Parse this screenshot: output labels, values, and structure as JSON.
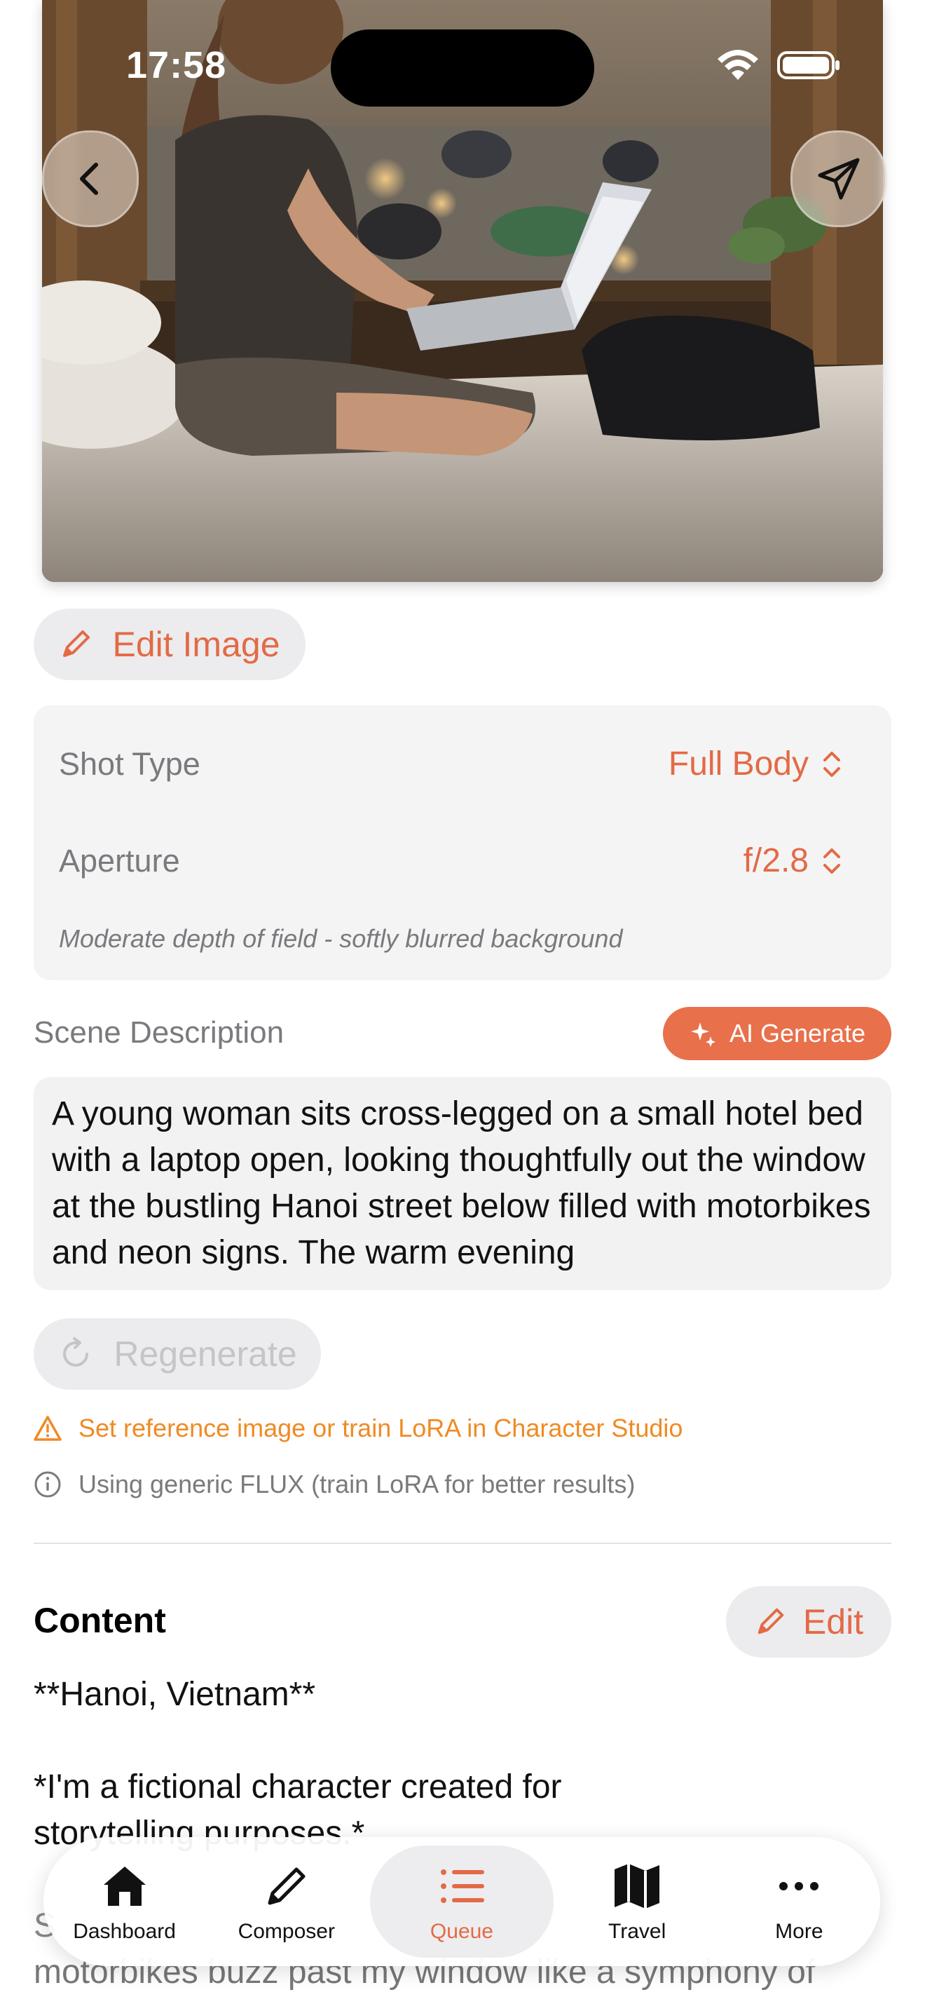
{
  "status_bar": {
    "time": "17:58"
  },
  "header": {
    "back_icon": "chevron-left-icon",
    "share_icon": "paper-plane-icon"
  },
  "edit_image_button": {
    "label": "Edit Image",
    "icon": "pencil-icon"
  },
  "camera_settings": {
    "shot_type": {
      "label": "Shot Type",
      "value": "Full Body"
    },
    "aperture": {
      "label": "Aperture",
      "value": "f/2.8"
    },
    "hint": "Moderate depth of field - softly blurred background"
  },
  "scene": {
    "label": "Scene Description",
    "ai_button": "AI Generate",
    "text": "A young woman sits cross-legged on a small hotel bed with a laptop open, looking thoughtfully out the window at the bustling Hanoi street below filled with motorbikes and neon signs. The warm evening"
  },
  "regenerate_button": "Regenerate",
  "warning": "Set reference image or train LoRA in Character Studio",
  "info": "Using generic FLUX (train LoRA for better results)",
  "content": {
    "title": "Content",
    "edit_button": "Edit",
    "line1": "**Hanoi, Vietnam**",
    "line2": "*I'm a fictional character created for storytelling purposes.*",
    "line3_start": "S",
    "line4": "motorbikes buzz past my window like a symphony of"
  },
  "tabbar": {
    "tabs": [
      {
        "label": "Dashboard",
        "icon": "house-icon"
      },
      {
        "label": "Composer",
        "icon": "pencil-icon"
      },
      {
        "label": "Queue",
        "icon": "list-icon"
      },
      {
        "label": "Travel",
        "icon": "map-icon"
      },
      {
        "label": "More",
        "icon": "ellipsis-icon"
      }
    ],
    "active": "Queue"
  },
  "colors": {
    "accent": "#e36a45",
    "warning": "#f08a24",
    "muted": "#7a7a7e"
  }
}
